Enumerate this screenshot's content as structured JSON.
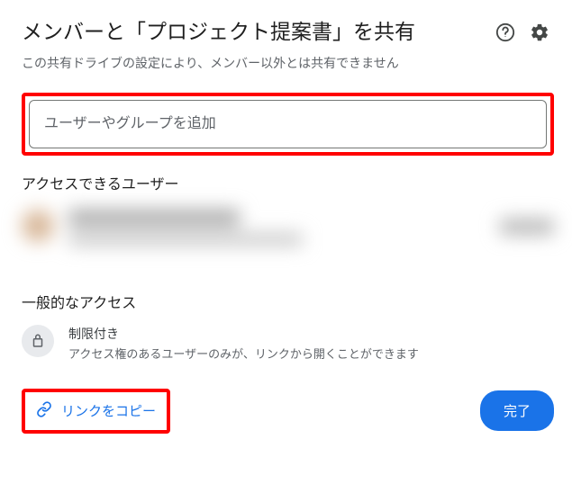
{
  "header": {
    "title": "メンバーと「プロジェクト提案書」を共有"
  },
  "subtitle": "この共有ドライブの設定により、メンバー以外とは共有できません",
  "input": {
    "placeholder": "ユーザーやグループを追加"
  },
  "sections": {
    "access_users_heading": "アクセスできるユーザー",
    "general_access_heading": "一般的なアクセス"
  },
  "general_access": {
    "title": "制限付き",
    "desc": "アクセス権のあるユーザーのみが、リンクから開くことができます"
  },
  "footer": {
    "copy_link": "リンクをコピー",
    "done": "完了"
  }
}
